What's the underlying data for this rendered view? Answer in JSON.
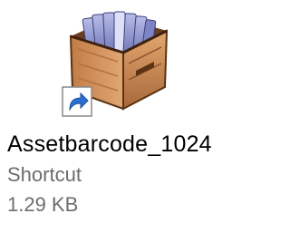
{
  "file": {
    "name": "Assetbarcode_1024",
    "type": "Shortcut",
    "size": "1.29 KB",
    "icon": "card-file-box-icon",
    "overlay_icon": "shortcut-arrow-icon"
  },
  "colors": {
    "name_text": "#000000",
    "meta_text": "#6d6d6d",
    "box_wood": "#c98a52",
    "cards": "#8a90c8",
    "badge_blue": "#2d6fd0"
  }
}
